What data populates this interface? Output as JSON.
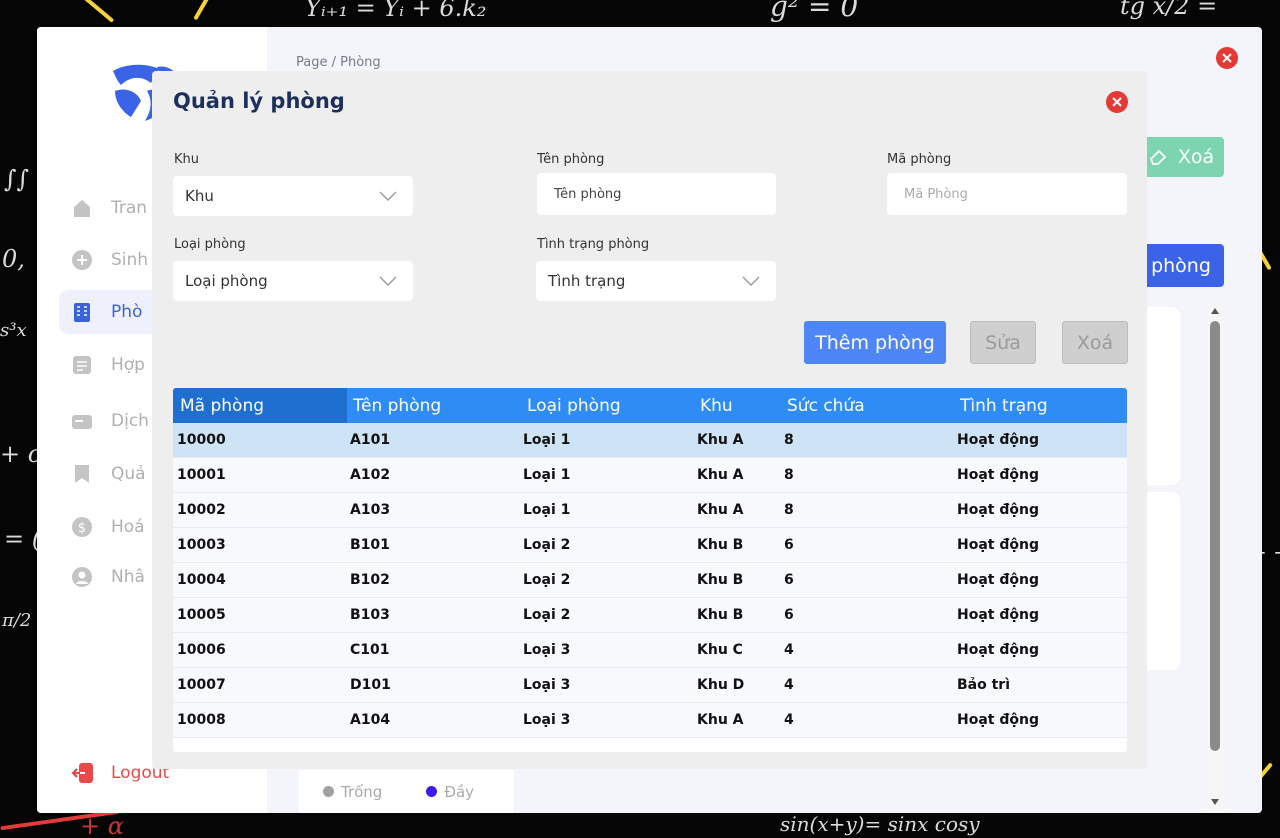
{
  "background": {
    "formulas": [
      "Yᵢ₊₁ = Yᵢ + 6.k₂",
      "g² = 0",
      "tg x/2 =",
      "∫∫",
      "0,",
      "s³x",
      "+ c",
      "= (",
      "π/2",
      "+ ɑ",
      "sin(x+y)= sinx cosy",
      "+ +"
    ]
  },
  "sidebar": {
    "items": [
      {
        "label": "Tran",
        "icon": "home-icon"
      },
      {
        "label": "Sinh",
        "icon": "plus-circle-icon"
      },
      {
        "label": "Phò",
        "icon": "building-icon"
      },
      {
        "label": "Hợp",
        "icon": "contract-icon"
      },
      {
        "label": "Dịch",
        "icon": "service-icon"
      },
      {
        "label": "Quả",
        "icon": "bookmark-icon"
      },
      {
        "label": "Hoá",
        "icon": "dollar-icon"
      },
      {
        "label": "Nhâ",
        "icon": "user-icon"
      }
    ],
    "logout_label": "Logout"
  },
  "main": {
    "breadcrumb": "Page / Phòng",
    "xoa_label": "Xoá",
    "add_label": "phòng",
    "legend": [
      {
        "label": "Trống",
        "color": "#a0a0a0"
      },
      {
        "label": "Đầy",
        "color": "#3b1bf0"
      }
    ]
  },
  "modal": {
    "title": "Quản lý phòng",
    "fields": {
      "khu": {
        "label": "Khu",
        "value": "Khu"
      },
      "ten_phong": {
        "label": "Tên phòng",
        "placeholder": "Tên phòng"
      },
      "ma_phong": {
        "label": "Mã phòng",
        "placeholder": "Mã Phòng"
      },
      "loai_phong": {
        "label": "Loại phòng",
        "value": "Loại phòng"
      },
      "tinh_trang": {
        "label": "Tình trạng phòng",
        "value": "Tình trạng"
      }
    },
    "buttons": {
      "add": "Thêm phòng",
      "edit": "Sửa",
      "delete": "Xoá"
    },
    "table": {
      "headers": [
        "Mã phòng",
        "Tên phòng",
        "Loại phòng",
        "Khu",
        "Sức chứa",
        "Tình trạng"
      ],
      "rows": [
        [
          "10000",
          "A101",
          "Loại 1",
          "Khu A",
          "8",
          "Hoạt động"
        ],
        [
          "10001",
          "A102",
          "Loại 1",
          "Khu A",
          "8",
          "Hoạt động"
        ],
        [
          "10002",
          "A103",
          "Loại 1",
          "Khu A",
          "8",
          "Hoạt động"
        ],
        [
          "10003",
          "B101",
          "Loại 2",
          "Khu B",
          "6",
          "Hoạt động"
        ],
        [
          "10004",
          "B102",
          "Loại 2",
          "Khu B",
          "6",
          "Hoạt động"
        ],
        [
          "10005",
          "B103",
          "Loại 2",
          "Khu B",
          "6",
          "Hoạt động"
        ],
        [
          "10006",
          "C101",
          "Loại 3",
          "Khu C",
          "4",
          "Hoạt động"
        ],
        [
          "10007",
          "D101",
          "Loại 3",
          "Khu D",
          "4",
          "Bảo trì"
        ],
        [
          "10008",
          "A104",
          "Loại 3",
          "Khu A",
          "4",
          "Hoạt động"
        ]
      ],
      "selected_row": 0
    }
  },
  "colors": {
    "primary": "#4f86f7",
    "header": "#2f8cf5",
    "danger": "#e53935"
  }
}
